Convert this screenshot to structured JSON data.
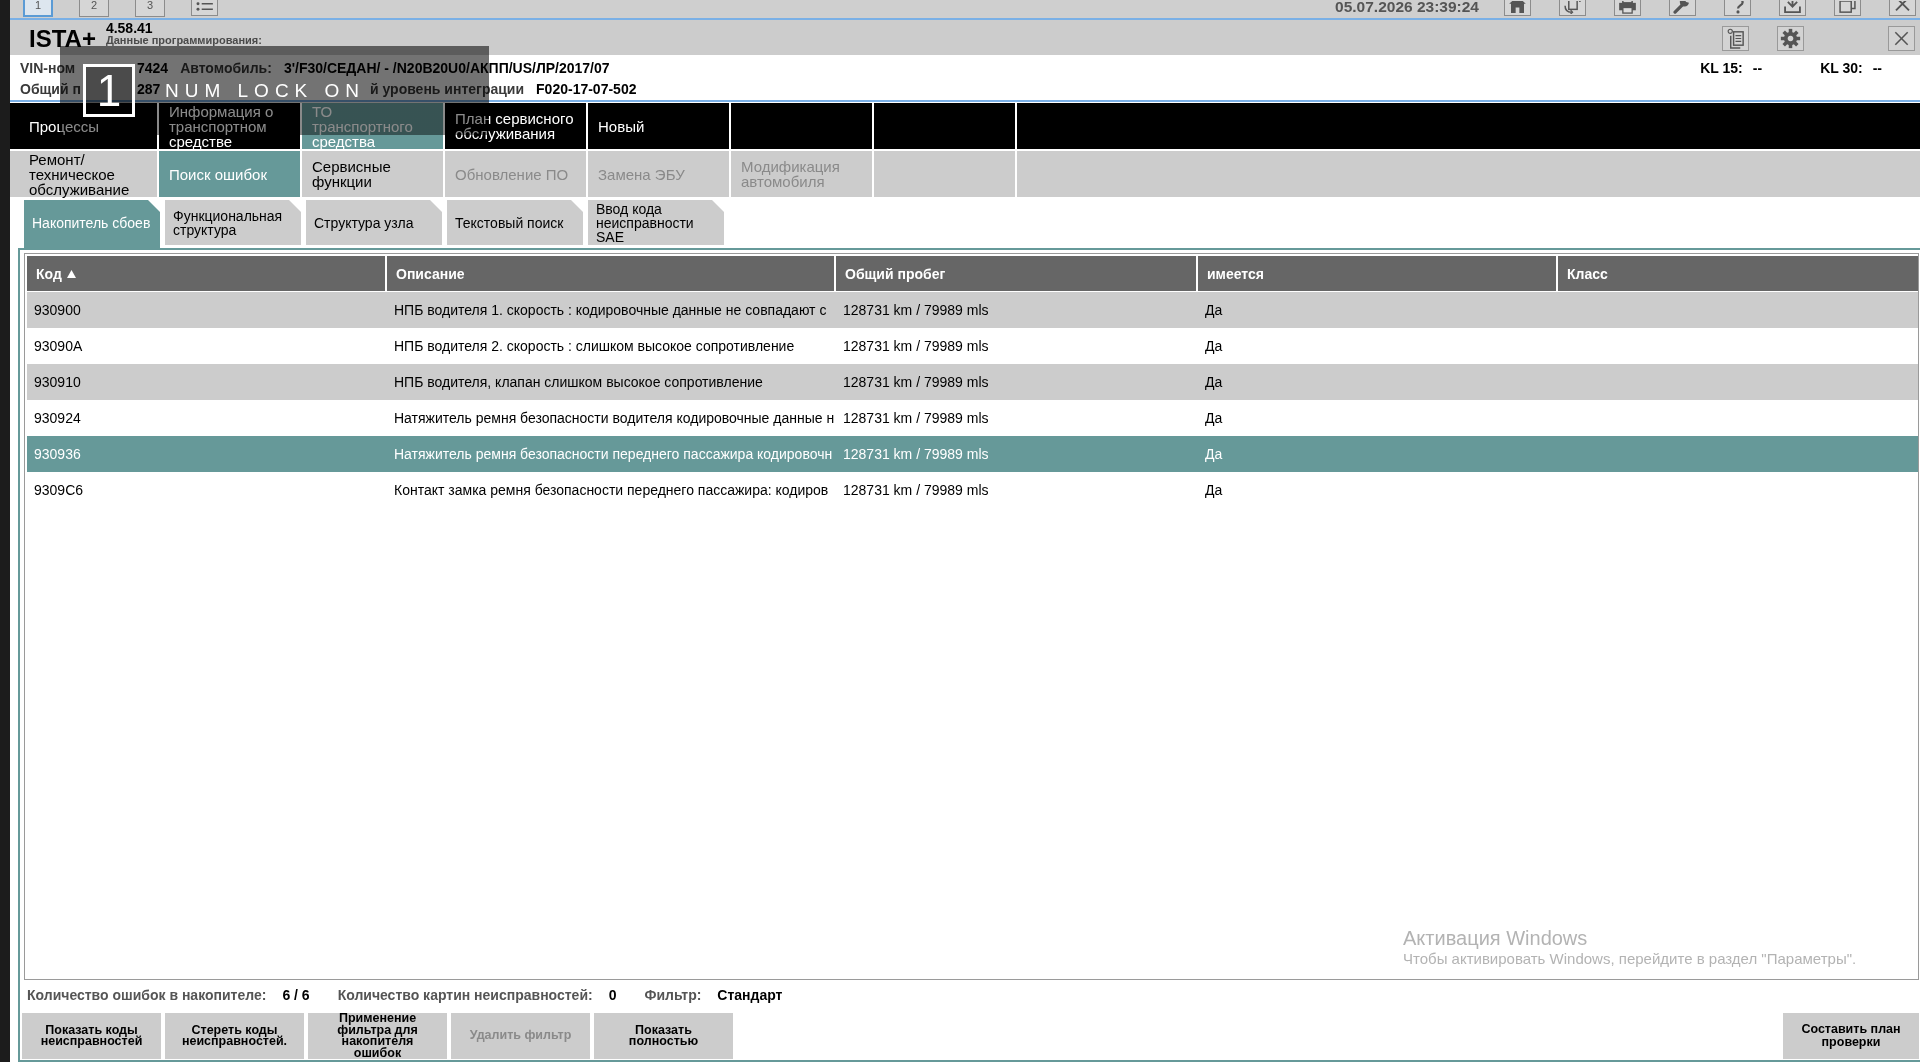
{
  "top_bar": {
    "tabs": [
      {
        "label": "1",
        "selected": true
      },
      {
        "label": "2",
        "selected": false
      },
      {
        "label": "3",
        "selected": false
      }
    ],
    "datetime": "05.07.2026 23:39:24"
  },
  "title_bar": {
    "app_name": "ISTA+",
    "version": "4.58.41",
    "subtitle": "Данные программирования:"
  },
  "vehicle_info": {
    "rows": [
      {
        "left_of_key": [
          {
            "kind": "label",
            "text": "VIN-ном"
          }
        ],
        "right_of_key": [
          {
            "kind": "value",
            "text": "7424"
          },
          {
            "kind": "label",
            "text": "Автомобиль:"
          },
          {
            "kind": "value",
            "text": "3'/F30/СЕДАН/ - /N20B20U0/АКПП/US/ЛР/2017/07"
          }
        ]
      },
      {
        "left_of_key": [
          {
            "kind": "label",
            "text": "Общий п"
          }
        ],
        "right_of_key": [
          {
            "kind": "value",
            "text": "287"
          }
        ],
        "right_of_message": [
          {
            "kind": "label",
            "text": "й уровень интеграции"
          },
          {
            "kind": "value",
            "text": "F020-17-07-502"
          }
        ]
      }
    ],
    "terminals": [
      {
        "label": "KL 15:",
        "value": "--"
      },
      {
        "label": "KL 30:",
        "value": "--"
      }
    ]
  },
  "num_lock_osd": {
    "key": "1",
    "message": "NUM LOCK ON"
  },
  "menu": {
    "rows": [
      {
        "kind": "primary",
        "label": "Процессы",
        "items": [
          {
            "label": "Информация о транспортном средстве",
            "selected": false,
            "disabled": false
          },
          {
            "label": "ТО транспортного средства",
            "selected": true,
            "disabled": false
          },
          {
            "label": "План сервисного обслуживания",
            "selected": false,
            "disabled": false
          },
          {
            "label": "Новый",
            "selected": false,
            "disabled": false
          }
        ]
      },
      {
        "kind": "secondary",
        "label": "Ремонт/ техническое обслуживание",
        "items": [
          {
            "label": "Поиск ошибок",
            "selected": true,
            "disabled": false
          },
          {
            "label": "Сервисные функции",
            "selected": false,
            "disabled": false
          },
          {
            "label": "Обновление ПО",
            "selected": false,
            "disabled": true
          },
          {
            "label": "Замена ЭБУ",
            "selected": false,
            "disabled": true
          },
          {
            "label": "Модификация автомобиля",
            "selected": false,
            "disabled": true
          }
        ]
      }
    ]
  },
  "subtabs": [
    {
      "label": "Накопитель сбоев",
      "selected": true
    },
    {
      "label": "Функциональная структура",
      "selected": false
    },
    {
      "label": "Структура узла",
      "selected": false
    },
    {
      "label": "Текстовый поиск",
      "selected": false
    },
    {
      "label": "Ввод кода неисправности SAE",
      "selected": false
    }
  ],
  "table": {
    "columns": [
      {
        "label": "Код",
        "sorted": true
      },
      {
        "label": "Описание",
        "sorted": false
      },
      {
        "label": "Общий пробег",
        "sorted": false
      },
      {
        "label": "имеется",
        "sorted": false
      },
      {
        "label": "Класс",
        "sorted": false
      }
    ],
    "rows": [
      {
        "cells": [
          "930900",
          "НПБ водителя 1. скорость : кодировочные данные не совпадают с",
          "128731 km / 79989 mls",
          "Да"
        ],
        "selected": false
      },
      {
        "cells": [
          "93090A",
          "НПБ водителя 2. скорость : слишком высокое сопротивление",
          "128731 km / 79989 mls",
          "Да"
        ],
        "selected": false
      },
      {
        "cells": [
          "930910",
          "НПБ водителя, клапан слишком высокое сопротивление",
          "128731 km / 79989 mls",
          "Да"
        ],
        "selected": false
      },
      {
        "cells": [
          "930924",
          "Натяжитель ремня безопасности водителя кодировочные данные н",
          "128731 km / 79989 mls",
          "Да"
        ],
        "selected": false
      },
      {
        "cells": [
          "930936",
          "Натяжитель ремня безопасности переднего пассажира кодировочн",
          "128731 km / 79989 mls",
          "Да"
        ],
        "selected": true
      },
      {
        "cells": [
          "9309C6",
          "Контакт замка ремня безопасности переднего пассажира: кодиров",
          "128731 km / 79989 mls",
          "Да"
        ],
        "selected": false
      }
    ]
  },
  "activation_notice": {
    "title": "Активация Windows",
    "message": "Чтобы активировать Windows, перейдите в раздел \"Параметры\"."
  },
  "footer": {
    "status": [
      {
        "label": "Количество ошибок в накопителе:",
        "value": "6 / 6"
      },
      {
        "label": "Количество картин неисправностей:",
        "value": "0"
      },
      {
        "label": "Фильтр:",
        "value": "Стандарт"
      }
    ],
    "buttons": [
      {
        "label": "Показать коды неисправностей",
        "disabled": false
      },
      {
        "label": "Стереть коды неисправностей.",
        "disabled": false
      },
      {
        "label": "Применение фильтра для накопителя ошибок",
        "disabled": false
      },
      {
        "label": "Удалить фильтр",
        "disabled": true
      },
      {
        "label": "Показать полностью",
        "disabled": false
      }
    ],
    "action_button": {
      "label": "Составить план проверки",
      "disabled": false
    }
  }
}
